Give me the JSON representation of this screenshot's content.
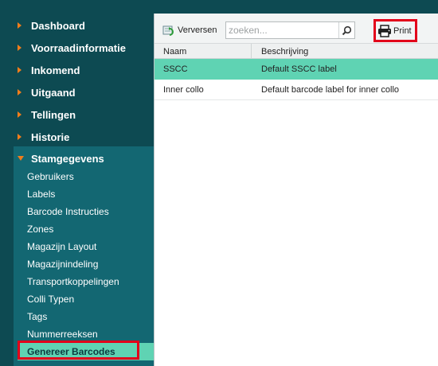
{
  "sidebar": {
    "nav_items": [
      {
        "label": "Dashboard"
      },
      {
        "label": "Voorraadinformatie"
      },
      {
        "label": "Inkomend"
      },
      {
        "label": "Uitgaand"
      },
      {
        "label": "Tellingen"
      },
      {
        "label": "Historie"
      }
    ],
    "section": {
      "label": "Stamgegevens",
      "items": [
        {
          "label": "Gebruikers"
        },
        {
          "label": "Labels"
        },
        {
          "label": "Barcode Instructies"
        },
        {
          "label": "Zones"
        },
        {
          "label": "Magazijn Layout"
        },
        {
          "label": "Magazijnindeling"
        },
        {
          "label": "Transportkoppelingen"
        },
        {
          "label": "Colli Typen"
        },
        {
          "label": "Tags"
        },
        {
          "label": "Nummerreeksen"
        },
        {
          "label": "Genereer Barcodes",
          "active": true
        }
      ]
    }
  },
  "toolbar": {
    "refresh_label": "Verversen",
    "search_placeholder": "zoeken...",
    "search_value": "",
    "print_label": "Print"
  },
  "grid": {
    "columns": [
      "Naam",
      "Beschrijving"
    ],
    "rows": [
      {
        "naam": "SSCC",
        "beschrijving": "Default SSCC label",
        "selected": true
      },
      {
        "naam": "Inner collo",
        "beschrijving": "Default barcode label for inner collo",
        "selected": false
      }
    ]
  },
  "colors": {
    "sidebar_bg": "#0d4a52",
    "section_bg": "#136772",
    "accent": "#5fd3b3",
    "arrow": "#f07d1b",
    "highlight_box": "#e2001a"
  },
  "icons": {
    "refresh": "refresh-icon",
    "search": "search-icon",
    "print": "printer-icon",
    "collapsed": "caret-right-icon",
    "expanded": "caret-down-icon"
  }
}
